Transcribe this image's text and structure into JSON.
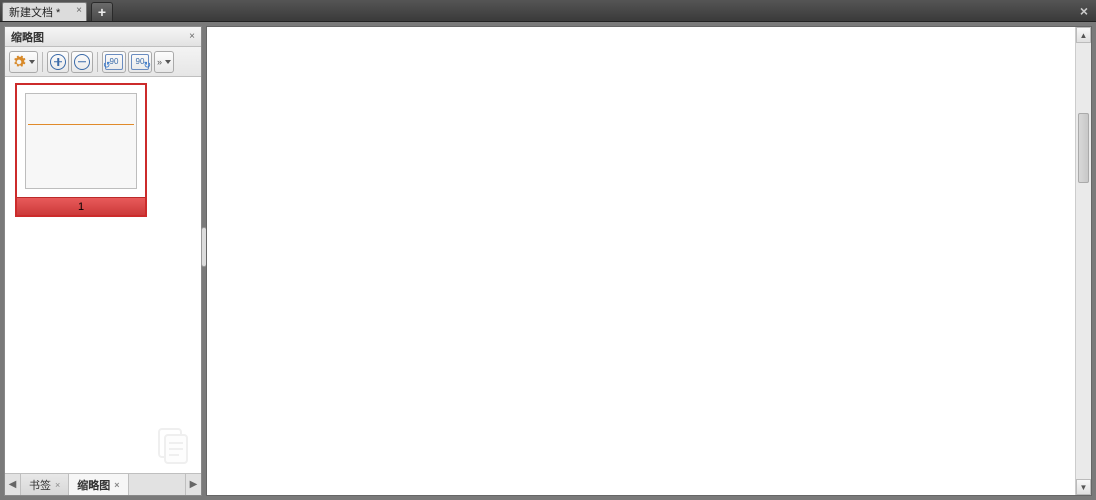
{
  "tabbar": {
    "document_tab_label": "新建文档 *",
    "new_tab_label": "+",
    "close_label": "×"
  },
  "side_panel": {
    "header_title": "缩略图",
    "header_close": "×",
    "toolbar": {
      "options_icon": "gear-icon",
      "zoom_in_icon": "plus-circle-icon",
      "zoom_out_icon": "minus-circle-icon",
      "rotate_left_label": "90",
      "rotate_right_label": "90",
      "more_icon": "chevrons-icon"
    },
    "thumbnail": {
      "page_number": "1"
    },
    "bottom_tabs": {
      "bookmarks_label": "书签",
      "bookmarks_close": "×",
      "thumbnails_label": "缩略图",
      "thumbnails_close": "×"
    }
  }
}
